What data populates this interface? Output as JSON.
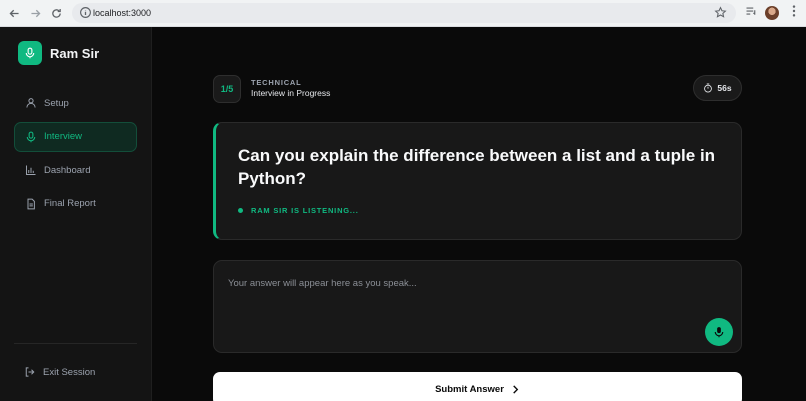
{
  "browser": {
    "url": "localhost:3000"
  },
  "sidebar": {
    "brand": "Ram Sir",
    "items": [
      {
        "label": "Setup",
        "icon": "user-icon",
        "active": false
      },
      {
        "label": "Interview",
        "icon": "mic-icon",
        "active": true
      },
      {
        "label": "Dashboard",
        "icon": "bar-chart-icon",
        "active": false
      },
      {
        "label": "Final Report",
        "icon": "document-icon",
        "active": false
      }
    ],
    "exit_label": "Exit Session"
  },
  "question": {
    "counter": "1/5",
    "category": "TECHNICAL",
    "status": "Interview in Progress",
    "timer": "56s",
    "text": "Can you explain the difference between a list and a tuple in Python?",
    "listening": "RAM SIR IS LISTENING..."
  },
  "answer": {
    "placeholder": "Your answer will appear here as you speak..."
  },
  "submit_label": "Submit Answer",
  "colors": {
    "accent": "#10b981",
    "background": "#0a0a0a",
    "card": "#181818"
  }
}
